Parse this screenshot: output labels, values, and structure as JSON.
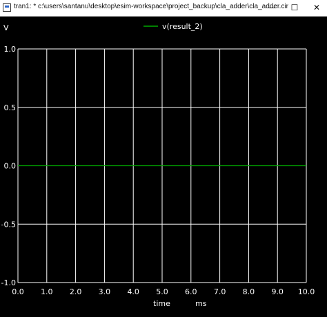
{
  "window": {
    "title": "tran1: * c:\\users\\santanu\\desktop\\esim-workspace\\project_backup\\cla_adder\\cla_adder.cir",
    "minimize_icon": "minimize-icon",
    "maximize_icon": "maximize-icon",
    "close_icon": "close-icon"
  },
  "plot": {
    "y_unit_label": "V",
    "x_label": "time",
    "x_unit_label": "ms",
    "background": "#000000",
    "grid_color": "#ffffff",
    "trace_color": "#00aa00"
  },
  "chart_data": {
    "type": "line",
    "title": "",
    "xlabel": "time",
    "ylabel": "V",
    "xlim": [
      0.0,
      10.0
    ],
    "ylim": [
      -1.0,
      1.0
    ],
    "grid": true,
    "legend": "top-center",
    "x_ticks": [
      "0.0",
      "1.0",
      "2.0",
      "3.0",
      "4.0",
      "5.0",
      "6.0",
      "7.0",
      "8.0",
      "9.0",
      "10.0"
    ],
    "y_ticks": [
      "1.0",
      "0.5",
      "0.0",
      "-0.5",
      "-1.0"
    ],
    "series": [
      {
        "name": "v(result_2)",
        "color": "#00aa00",
        "x": [
          0.0,
          10.0
        ],
        "y": [
          0.0,
          0.0
        ]
      }
    ]
  }
}
